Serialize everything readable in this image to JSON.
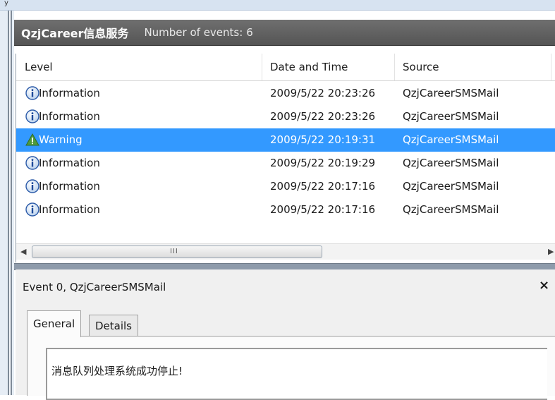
{
  "header": {
    "title": "QzjCareer信息服务",
    "count_label": "Number of events:",
    "count_value": "6"
  },
  "columns": {
    "level": "Level",
    "datetime": "Date and Time",
    "source": "Source"
  },
  "events": [
    {
      "level": "Information",
      "icon": "info-icon",
      "datetime": "2009/5/22 20:23:26",
      "source": "QzjCareerSMSMail"
    },
    {
      "level": "Information",
      "icon": "info-icon",
      "datetime": "2009/5/22 20:23:26",
      "source": "QzjCareerSMSMail"
    },
    {
      "level": "Warning",
      "icon": "warning-icon",
      "datetime": "2009/5/22 20:19:31",
      "source": "QzjCareerSMSMail",
      "selected": true
    },
    {
      "level": "Information",
      "icon": "info-icon",
      "datetime": "2009/5/22 20:19:29",
      "source": "QzjCareerSMSMail"
    },
    {
      "level": "Information",
      "icon": "info-icon",
      "datetime": "2009/5/22 20:17:16",
      "source": "QzjCareerSMSMail"
    },
    {
      "level": "Information",
      "icon": "info-icon",
      "datetime": "2009/5/22 20:17:16",
      "source": "QzjCareerSMSMail"
    }
  ],
  "scrollbar": {
    "grip": "III"
  },
  "detail": {
    "title": "Event 0, QzjCareerSMSMail",
    "close": "×",
    "tabs": [
      "General",
      "Details"
    ],
    "message": "消息队列处理系统成功停止!"
  },
  "colors": {
    "selection": "#3399ff",
    "header": "#5f5f5f"
  }
}
